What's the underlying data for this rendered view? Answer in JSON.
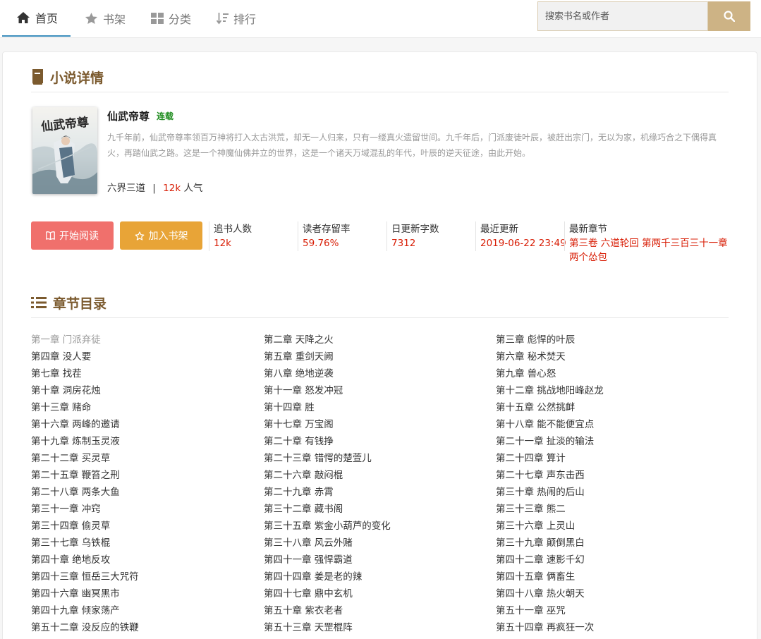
{
  "nav": {
    "home": "首页",
    "shelf": "书架",
    "category": "分类",
    "rank": "排行"
  },
  "search": {
    "placeholder": "搜索书名或作者"
  },
  "detail": {
    "section_title": "小说详情",
    "cover_title_text": "仙武帝尊",
    "title": "仙武帝尊",
    "status": "连载",
    "description": "九千年前，仙武帝尊率领百万神将打入太古洪荒，却无一人归来，只有一缕真火遗留世间。九千年后，门派废徒叶辰，被赶出宗门，无以为家，机缘巧合之下偶得真火，再踏仙武之路。这是一个神魔仙佛并立的世界，这是一个诸天万域混乱的年代，叶辰的逆天征途，由此开始。",
    "author": "六界三道",
    "separator": "|",
    "popularity": "12k",
    "popularity_label": "人气"
  },
  "buttons": {
    "read": "开始阅读",
    "add_shelf": "加入书架"
  },
  "stats": [
    {
      "label": "追书人数",
      "value": "12k"
    },
    {
      "label": "读者存留率",
      "value": "59.76%"
    },
    {
      "label": "日更新字数",
      "value": "7312"
    },
    {
      "label": "最近更新",
      "value": "2019-06-22 23:49"
    },
    {
      "label": "最新章节",
      "value": "第三卷 六道轮回 第两千三百三十一章 两个怂包"
    }
  ],
  "colors": {
    "accent_brown": "#7b5a2e",
    "highlight_red": "#d81e06",
    "read_button": "#f0706c",
    "shelf_button": "#e8a437",
    "search_button": "#cdb385",
    "status_green": "#1e8c1e",
    "nav_active_underline": "#3c8dbc"
  },
  "catalog": {
    "section_title": "章节目录",
    "chapters": [
      "第一章 门派弃徒",
      "第二章 天降之火",
      "第三章 彪悍的叶辰",
      "第四章 没人要",
      "第五章 重剑天阙",
      "第六章 秘术焚天",
      "第七章 找茬",
      "第八章 绝地逆袭",
      "第九章 兽心怒",
      "第十章 洞房花烛",
      "第十一章 怒发冲冠",
      "第十二章 挑战地阳峰赵龙",
      "第十三章 赌命",
      "第十四章 胜",
      "第十五章 公然挑衅",
      "第十六章 两峰的邀请",
      "第十七章 万宝阁",
      "第十八章 能不能便宜点",
      "第十九章 炼制玉灵液",
      "第二十章 有钱挣",
      "第二十一章 扯淡的输法",
      "第二十二章 买灵草",
      "第二十三章 错愕的楚萱儿",
      "第二十四章 算计",
      "第二十五章 鞭笞之刑",
      "第二十六章 敲闷棍",
      "第二十七章 声东击西",
      "第二十八章 两条大鱼",
      "第二十九章 赤霄",
      "第三十章 热闹的后山",
      "第三十一章 冲窍",
      "第三十二章 藏书阁",
      "第三十三章 熊二",
      "第三十四章 偷灵草",
      "第三十五章 紫金小葫芦的变化",
      "第三十六章 上灵山",
      "第三十七章 乌铁棍",
      "第三十八章 风云外赌",
      "第三十九章 颠倒黑白",
      "第四十章 绝地反攻",
      "第四十一章 强悍霸道",
      "第四十二章 速影千幻",
      "第四十三章 恒岳三大咒符",
      "第四十四章 姜是老的辣",
      "第四十五章 俩畜生",
      "第四十六章 幽冥黑市",
      "第四十七章 鼎中玄机",
      "第四十八章 热火朝天",
      "第四十九章 倾家荡产",
      "第五十章 紫衣老者",
      "第五十一章 巫咒",
      "第五十二章 没反应的铁鞭",
      "第五十三章 天罡棍阵",
      "第五十四章 再疯狂一次"
    ]
  }
}
